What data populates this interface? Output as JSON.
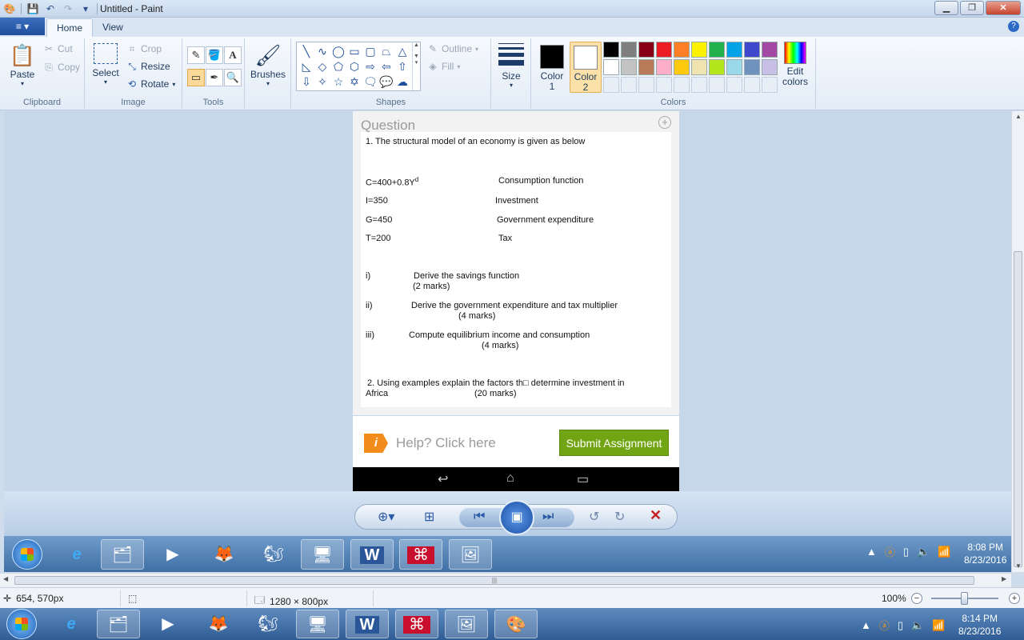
{
  "titlebar": {
    "title": "Untitled - Paint",
    "quick_access": [
      "save-icon",
      "undo-icon",
      "redo-icon",
      "customize-icon"
    ],
    "controls": [
      "minimize",
      "restore",
      "close"
    ]
  },
  "tabs": {
    "file": "≡ ▾",
    "home": "Home",
    "view": "View"
  },
  "ribbon": {
    "clipboard": {
      "label": "Clipboard",
      "paste": "Paste",
      "cut": "Cut",
      "copy": "Copy"
    },
    "image": {
      "label": "Image",
      "select": "Select",
      "crop": "Crop",
      "resize": "Resize",
      "rotate": "Rotate"
    },
    "tools": {
      "label": "Tools",
      "text": "A"
    },
    "brushes": {
      "label": "Brushes"
    },
    "shapes": {
      "label": "Shapes",
      "outline": "Outline",
      "fill": "Fill"
    },
    "size": {
      "label": "Size"
    },
    "colors": {
      "label": "Colors",
      "color1": "Color 1",
      "color1_value": "#000000",
      "color2": "Color 2",
      "color2_value": "#ffffff",
      "edit": "Edit colors",
      "palette_row1": [
        "#000000",
        "#7f7f7f",
        "#880015",
        "#ed1c24",
        "#ff7f27",
        "#fff200",
        "#22b14c",
        "#00a2e8",
        "#3f48cc",
        "#a349a4"
      ],
      "palette_row2": [
        "#ffffff",
        "#c3c3c3",
        "#b97a57",
        "#ffaec9",
        "#ffc90e",
        "#efe4b0",
        "#b5e61d",
        "#99d9ea",
        "#7092be",
        "#c8bfe7"
      ]
    }
  },
  "document": {
    "header": "Question",
    "q1": "1.  The structural model of an economy is given as below",
    "equations": [
      {
        "lhs": "C=400+0.8Y",
        "sup": "d",
        "desc": "Consumption function"
      },
      {
        "lhs": "I=350",
        "sup": "",
        "desc": "Investment"
      },
      {
        "lhs": "G=450",
        "sup": "",
        "desc": "Government expenditure"
      },
      {
        "lhs": "T=200",
        "sup": "",
        "desc": "Tax"
      }
    ],
    "parts": [
      {
        "num": "i)",
        "text": "Derive the savings function",
        "marks": "(2 marks)"
      },
      {
        "num": "ii)",
        "text": "Derive the government expenditure and tax multiplier",
        "marks": "(4 marks)"
      },
      {
        "num": "iii)",
        "text": "Compute equilibrium income and consumption",
        "marks": "(4 marks)"
      }
    ],
    "q2_line1": "2. Using examples explain the factors th□ determine investment in",
    "q2_line2": "Africa",
    "q2_marks": "(20 marks)",
    "help_badge": "i",
    "help_text": "Help? Click here",
    "submit": "Submit Assignment"
  },
  "inner_taskbar": {
    "time": "8:08 PM",
    "date": "8/23/2016"
  },
  "statusbar": {
    "cursor": "654, 570px",
    "size": "1280 × 800px",
    "zoom": "100%"
  },
  "outer_taskbar": {
    "time": "8:14 PM",
    "date": "8/23/2016"
  }
}
